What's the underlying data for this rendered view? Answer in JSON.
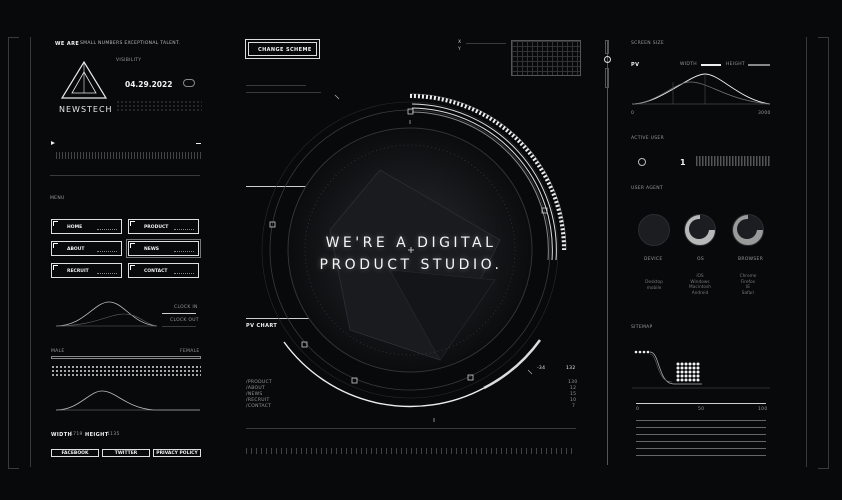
{
  "header": {
    "we_are": "WE ARE",
    "tagline": "SMALL NUMBERS EXCEPTIONAL TALENT.",
    "logo_name": "NEWSTECH",
    "date": "04.29.2022",
    "visibility_label": "VISIBILITY",
    "change_scheme": "CHANGE SCHEME"
  },
  "menu": {
    "title": "MENU",
    "items": [
      {
        "label": "HOME"
      },
      {
        "label": "PRODUCT"
      },
      {
        "label": "ABOUT"
      },
      {
        "label": "NEWS"
      },
      {
        "label": "RECRUIT"
      },
      {
        "label": "CONTACT"
      }
    ]
  },
  "clock": {
    "in": "CLOCK IN",
    "out": "CLOCK OUT"
  },
  "gender": {
    "male": "MALE",
    "female": "FEMALE"
  },
  "size": {
    "width_label": "WIDTH",
    "width_value": "1719",
    "height_label": "HEIGHT",
    "height_value": "1135"
  },
  "social": [
    {
      "label": "FACEBOOK"
    },
    {
      "label": "TWITTER"
    },
    {
      "label": "PRIVACY POLICY"
    }
  ],
  "hero": {
    "line1": "WE'RE A DIGITAL",
    "line2": "PRODUCT STUDIO."
  },
  "pv_chart": {
    "title": "PV CHART",
    "rows": [
      {
        "label": "/PRODUCT",
        "value": "130"
      },
      {
        "label": "/ABOUT",
        "value": "12"
      },
      {
        "label": "/NEWS",
        "value": "15"
      },
      {
        "label": "/RECRUIT",
        "value": "10"
      },
      {
        "label": "/CONTACT",
        "value": "7"
      }
    ],
    "neg_value": "-34",
    "pos_value": "132"
  },
  "coords": {
    "x_label": "X",
    "y_label": "Y"
  },
  "right": {
    "screen_size": "SCREEN SIZE",
    "pv": "PV",
    "width": "WIDTH",
    "height": "HEIGHT",
    "axis_min": "0",
    "axis_max": "3000",
    "active_user": "ACTIVE USER",
    "active_count": "1",
    "user_agent": "USER AGENT",
    "device": "DEVICE",
    "os": "OS",
    "browser": "BROWSER",
    "device_value": "Desktop\nmobile",
    "os_value": "iOS\nWindows\nMacintosh\nAndroid",
    "browser_value": "Chrome\nFirefox\nIE\nSafari",
    "sitemap": "SITEMAP",
    "sitemap_axis": [
      "0",
      "50",
      "100"
    ]
  },
  "colors": {
    "background": "#08090b",
    "foreground": "#f2f2f2",
    "muted": "#6a6a6a"
  }
}
